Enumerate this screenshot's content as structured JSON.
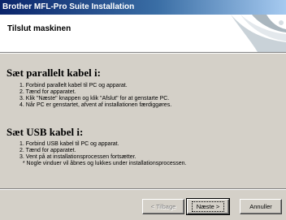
{
  "window": {
    "title": "Brother MFL-Pro Suite Installation"
  },
  "header": {
    "title": "Tilslut maskinen"
  },
  "sections": [
    {
      "title": "Sæt parallelt kabel i:",
      "steps": [
        "1. Forbind parallelt kabel til PC og apparat.",
        "2. Tænd for apparatet.",
        "3. Klik \"Næste\" knappen og klik \"Afslut\" for at genstarte PC.",
        "4. Når PC er genstartet, afvent af installationen færdiggøres."
      ]
    },
    {
      "title": "Sæt USB kabel i:",
      "steps": [
        "1. Forbind USB kabel til PC og apparat.",
        "2. Tænd for apparatet.",
        "3. Vent på at installationsprocessen fortsætter.",
        "  * Nogle vinduer vil åbnes og lukkes under installationsprocessen."
      ]
    }
  ],
  "buttons": {
    "back": "< Tilbage",
    "next": "Næste >",
    "cancel": "Annuller"
  }
}
